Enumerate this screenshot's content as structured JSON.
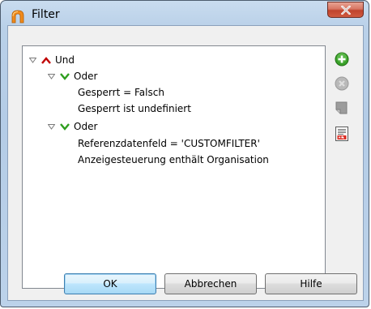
{
  "window": {
    "title": "Filter"
  },
  "tree": {
    "nodes": [
      {
        "label": "Und",
        "type": "operator-and"
      },
      {
        "label": "Oder",
        "type": "operator-or"
      },
      {
        "label": "Gesperrt = Falsch",
        "type": "condition"
      },
      {
        "label": "Gesperrt ist undefiniert",
        "type": "condition"
      },
      {
        "label": "Oder",
        "type": "operator-or"
      },
      {
        "label": "Referenzdatenfeld = 'CUSTOMFILTER'",
        "type": "condition"
      },
      {
        "label": "Anzeigesteuerung enthält Organisation",
        "type": "condition"
      }
    ]
  },
  "toolbar": {
    "icons": [
      "add-icon",
      "remove-icon",
      "edit-icon",
      "sql-icon"
    ]
  },
  "buttons": {
    "ok": "OK",
    "cancel": "Abbrechen",
    "help": "Hilfe"
  },
  "colors": {
    "and_operator": "#c00000",
    "or_operator": "#2e9e1e",
    "add_green": "#3aa12a"
  }
}
